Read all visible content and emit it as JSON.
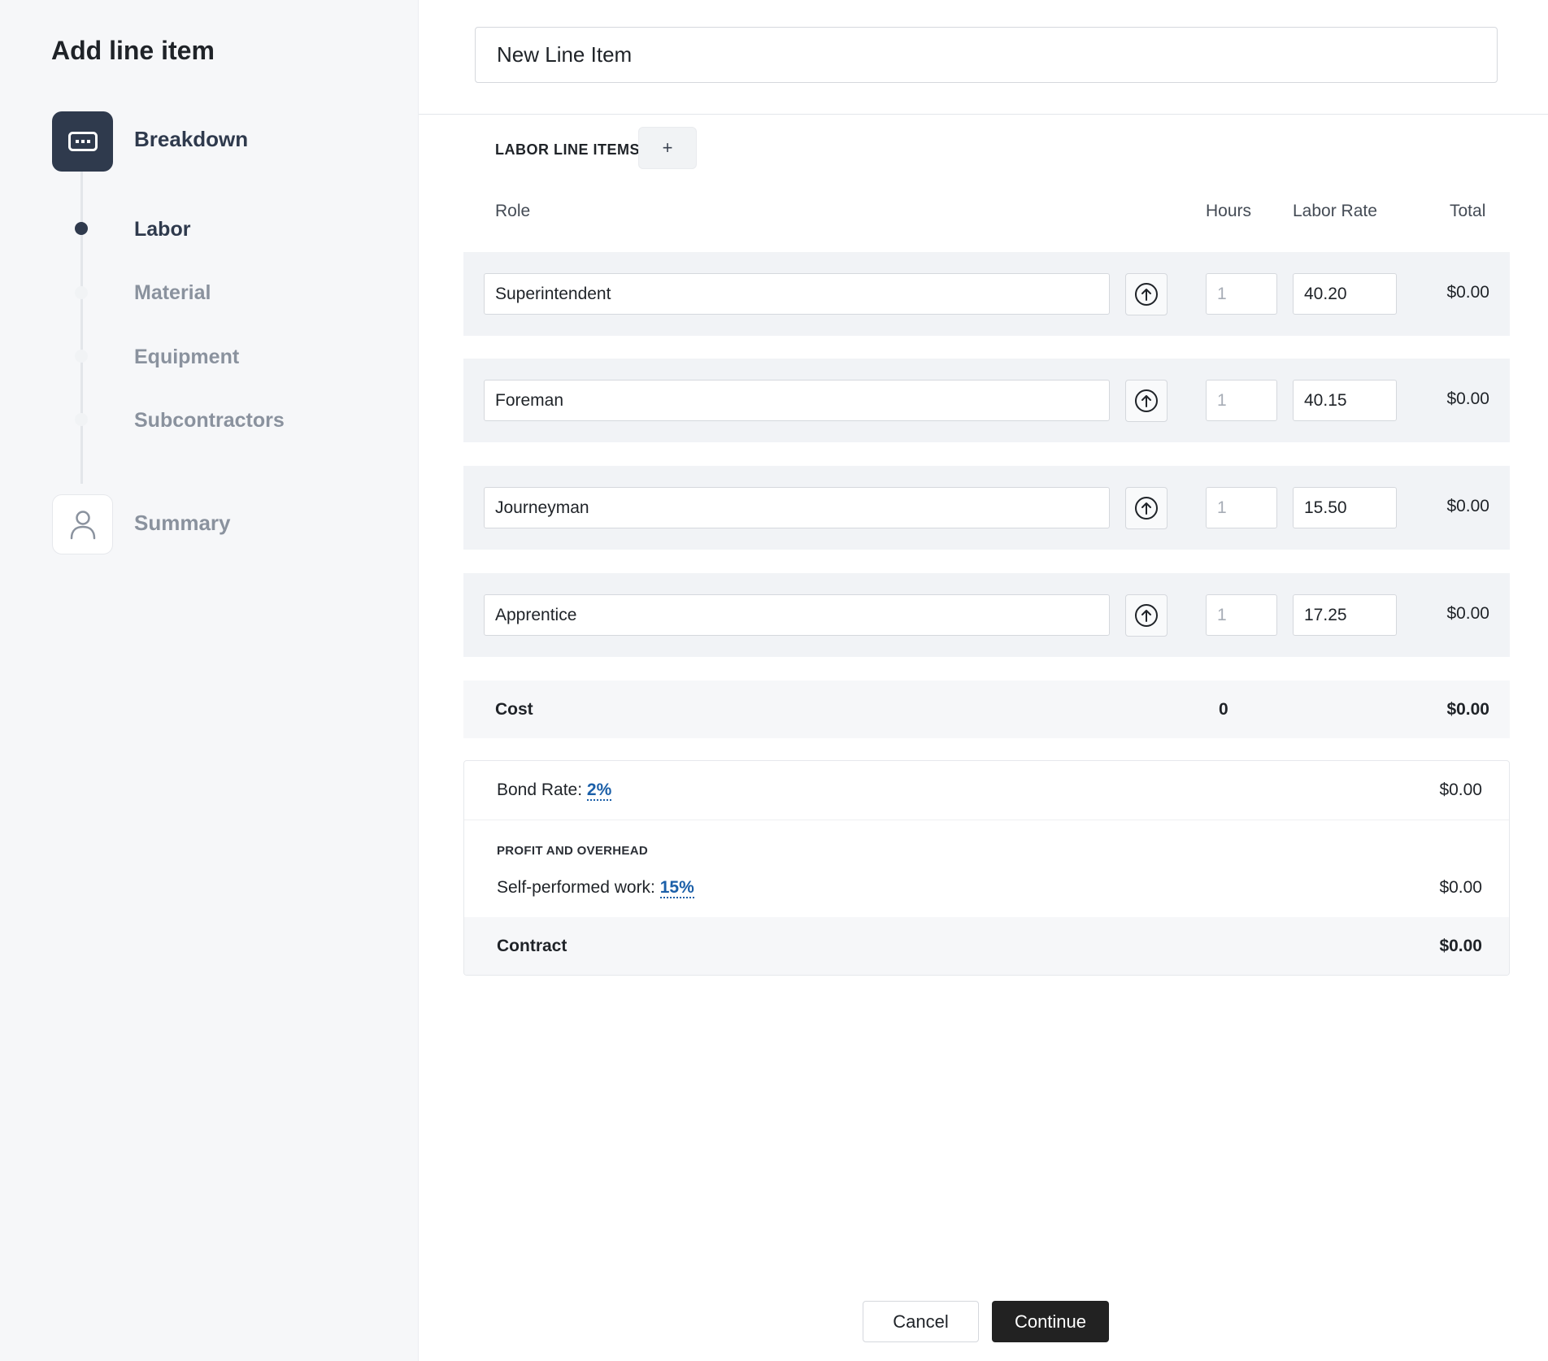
{
  "sidebar": {
    "title": "Add line item",
    "steps": [
      {
        "label": "Breakdown",
        "icon": "keyboard-icon",
        "state": "active"
      },
      {
        "label": "Summary",
        "icon": "user-icon",
        "state": "inactive"
      }
    ],
    "substeps": [
      {
        "label": "Labor",
        "state": "active"
      },
      {
        "label": "Material",
        "state": "inactive"
      },
      {
        "label": "Equipment",
        "state": "inactive"
      },
      {
        "label": "Subcontractors",
        "state": "inactive"
      }
    ]
  },
  "line_item": {
    "name": "New Line Item"
  },
  "labor": {
    "section_label": "LABOR LINE ITEMS",
    "add_label": "+",
    "columns": {
      "role": "Role",
      "hours": "Hours",
      "rate": "Labor Rate",
      "total": "Total"
    },
    "rows": [
      {
        "role": "Superintendent",
        "hours_placeholder": "1",
        "rate": "40.20",
        "total": "$0.00"
      },
      {
        "role": "Foreman",
        "hours_placeholder": "1",
        "rate": "40.15",
        "total": "$0.00"
      },
      {
        "role": "Journeyman",
        "hours_placeholder": "1",
        "rate": "15.50",
        "total": "$0.00"
      },
      {
        "role": "Apprentice",
        "hours_placeholder": "1",
        "rate": "17.25",
        "total": "$0.00"
      }
    ],
    "cost": {
      "label": "Cost",
      "hours": "0",
      "total": "$0.00"
    }
  },
  "summary": {
    "bond_label": "Bond Rate:",
    "bond_pct": "2%",
    "bond_amount": "$0.00",
    "poh_label": "PROFIT AND OVERHEAD",
    "spw_label": "Self-performed work:",
    "spw_pct": "15%",
    "spw_amount": "$0.00",
    "contract_label": "Contract",
    "contract_amount": "$0.00"
  },
  "footer": {
    "cancel_label": "Cancel",
    "continue_label": "Continue"
  },
  "colors": {
    "sidebar_bg": "#f6f7f9",
    "active_step": "#2f3a4d",
    "link": "#1b5fa8",
    "primary_button": "#222222"
  }
}
